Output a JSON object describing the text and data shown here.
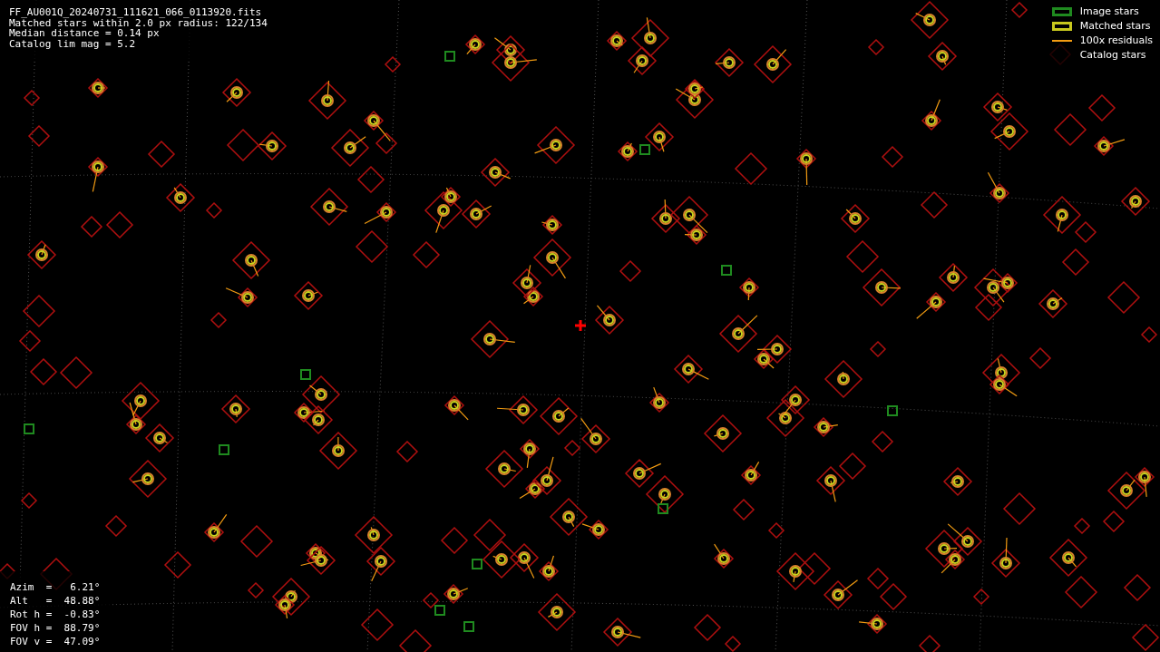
{
  "info": {
    "lines": [
      "FF_AU001Q_20240731_111621_066_0113920.fits",
      "Matched stars within 2.0 px radius: 122/134",
      "Median distance = 0.14 px",
      "Catalog lim mag = 5.2"
    ]
  },
  "legend": [
    {
      "kind": "box",
      "label": "Image stars",
      "color": "#1f8a1f"
    },
    {
      "kind": "box",
      "label": "Matched stars",
      "color": "#c8c81e"
    },
    {
      "kind": "line",
      "label": "100x residuals",
      "color": "#f39c12"
    },
    {
      "kind": "none",
      "label": "Catalog stars"
    }
  ],
  "pointing": {
    "lines": [
      "Azim  =   6.21°",
      "Alt   =  48.88°",
      "Rot h =  -0.83°",
      "FOV h =  88.79°",
      "FOV v =  47.09°"
    ]
  }
}
